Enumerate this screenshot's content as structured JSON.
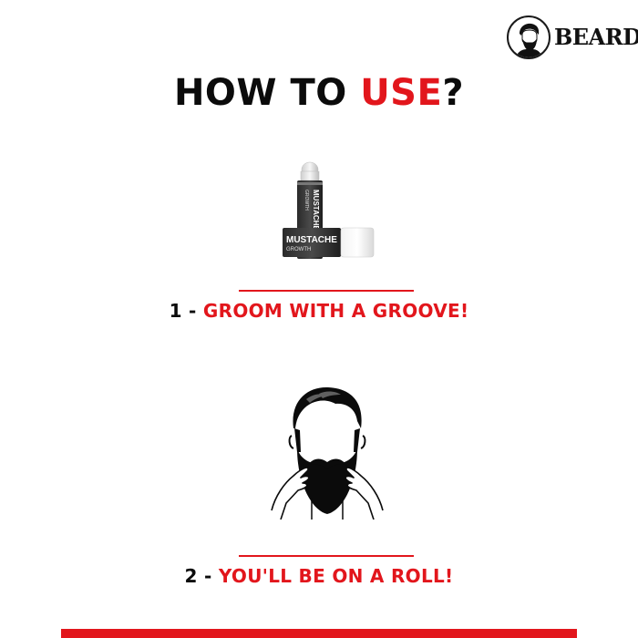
{
  "brand": {
    "wordmark": "BEARDO"
  },
  "headline": {
    "prefix": "HOW TO ",
    "accent": "USE",
    "suffix": "?"
  },
  "product": {
    "label_line1": "MUSTACHE",
    "label_line2": "GROWTH"
  },
  "steps": [
    {
      "number": "1 - ",
      "text": "GROOM WITH A GROOVE!"
    },
    {
      "number": "2 - ",
      "text": "YOU'LL BE ON A ROLL!"
    }
  ],
  "colors": {
    "accent": "#e2161c",
    "text": "#0b0b0b",
    "background": "#ffffff"
  },
  "icons": [
    "beardo-logo-icon",
    "bearded-man-illustration-icon",
    "roll-on-bottle-icon"
  ]
}
